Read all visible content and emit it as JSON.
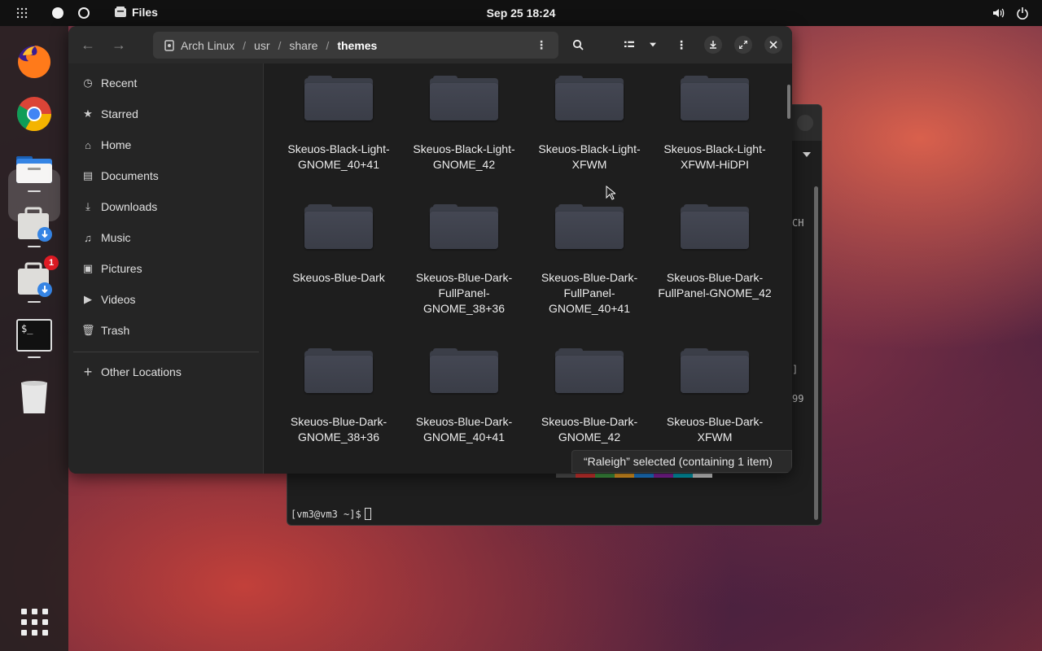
{
  "topbar": {
    "app_name": "Files",
    "clock": "Sep 25  18:24"
  },
  "dock": {
    "items": [
      "firefox-icon",
      "chrome-icon",
      "files-icon",
      "software-download-icon",
      "software-updates-icon",
      "terminal-icon",
      "trash-icon",
      "app-grid-icon"
    ],
    "badge_count": "1"
  },
  "files": {
    "path": [
      "Arch Linux",
      "usr",
      "share",
      "themes"
    ],
    "sidebar": {
      "items": [
        {
          "label": "Recent",
          "icon": "clock-icon"
        },
        {
          "label": "Starred",
          "icon": "star-icon"
        },
        {
          "label": "Home",
          "icon": "home-icon"
        },
        {
          "label": "Documents",
          "icon": "document-icon"
        },
        {
          "label": "Downloads",
          "icon": "download-icon"
        },
        {
          "label": "Music",
          "icon": "music-icon"
        },
        {
          "label": "Pictures",
          "icon": "picture-icon"
        },
        {
          "label": "Videos",
          "icon": "video-icon"
        },
        {
          "label": "Trash",
          "icon": "trash-icon"
        }
      ],
      "other_locations": "Other Locations"
    },
    "folders": [
      "Skeuos-Black-Light-GNOME_40+41",
      "Skeuos-Black-Light-GNOME_42",
      "Skeuos-Black-Light-XFWM",
      "Skeuos-Black-Light-XFWM-HiDPI",
      "Skeuos-Blue-Dark",
      "Skeuos-Blue-Dark-FullPanel-GNOME_38+36",
      "Skeuos-Blue-Dark-FullPanel-GNOME_40+41",
      "Skeuos-Blue-Dark-FullPanel-GNOME_42",
      "Skeuos-Blue-Dark-GNOME_38+36",
      "Skeuos-Blue-Dark-GNOME_40+41",
      "Skeuos-Blue-Dark-GNOME_42",
      "Skeuos-Blue-Dark-XFWM"
    ],
    "status": "“Raleigh” selected  (containing 1 item)"
  },
  "terminal": {
    "prompt": "[vm3@vm3 ~]$",
    "frag1": "CH",
    "frag2": "]",
    "frag3": "99",
    "palette": [
      "#555555",
      "#e53935",
      "#43a047",
      "#f9a825",
      "#1e88e5",
      "#8e24aa",
      "#00acc1",
      "#e0e0e0"
    ]
  }
}
